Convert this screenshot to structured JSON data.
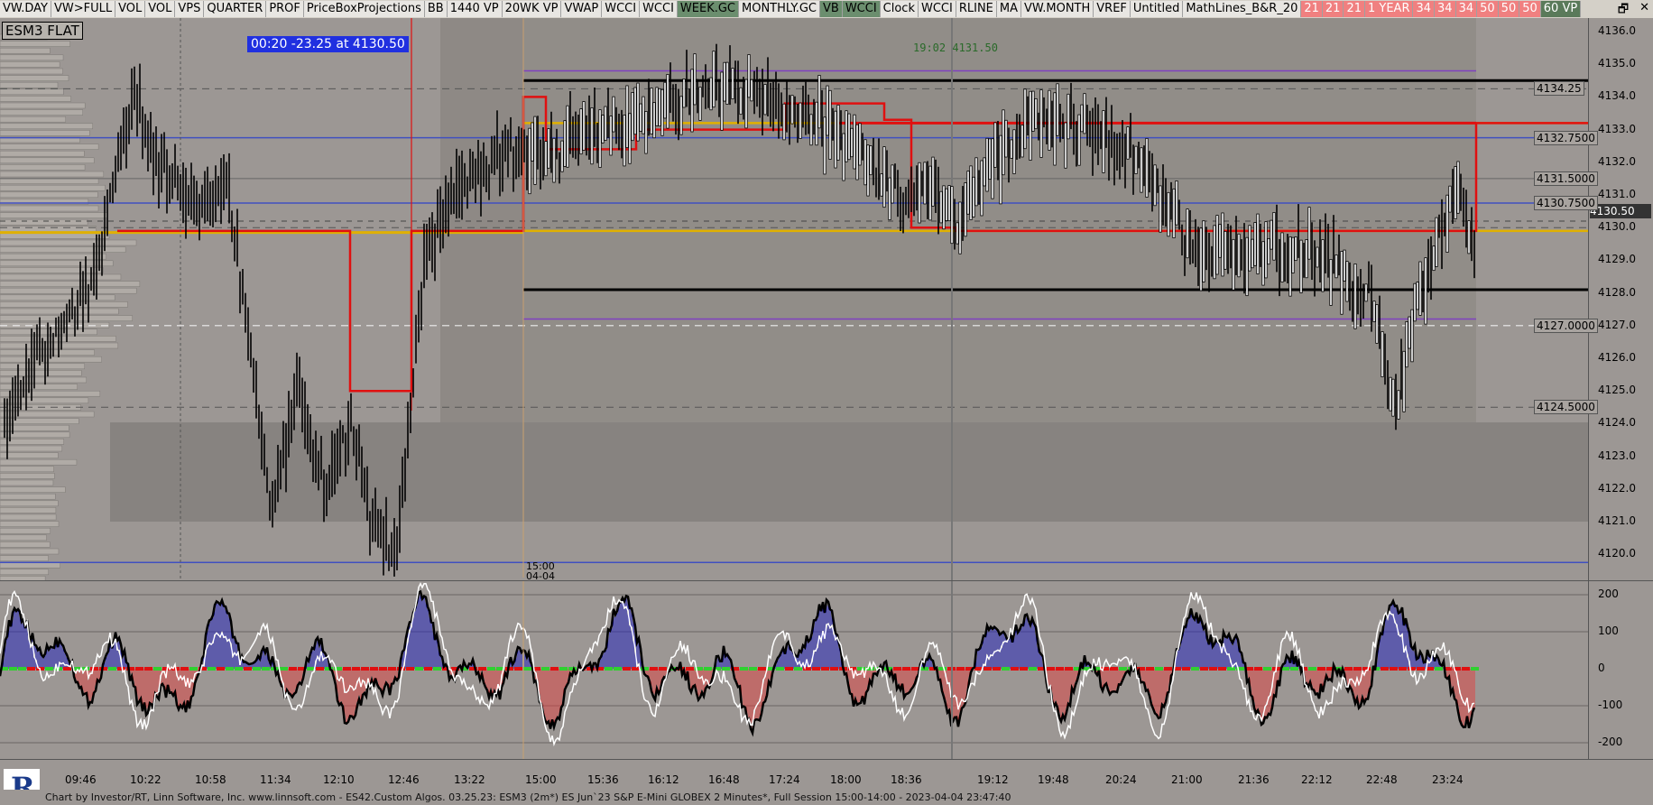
{
  "toolbar": {
    "buttons": [
      "VW.DAY",
      "VW>FULL",
      "VOL",
      "VOL",
      "VPS",
      "QUARTER",
      "PROF",
      "PriceBoxProjections",
      "BB",
      "1440 VP",
      "20WK VP",
      "VWAP",
      "WCCI",
      "WCCI",
      "WEEK.GC",
      "MONTHLY.GC",
      "VB",
      "WCCI",
      "Clock",
      "WCCI",
      "RLINE",
      "MA",
      "VW.MONTH",
      "VREF",
      "Untitled",
      "MathLines_B&R_20",
      "21",
      "21",
      "21",
      "1 YEAR",
      "34",
      "34",
      "34",
      "50",
      "50",
      "50",
      "60 VP"
    ],
    "styles": [
      "n",
      "n",
      "n",
      "n",
      "n",
      "n",
      "n",
      "n",
      "n",
      "n",
      "n",
      "n",
      "n",
      "n",
      "g",
      "n",
      "g",
      "g",
      "n",
      "n",
      "n",
      "n",
      "n",
      "n",
      "n",
      "n",
      "p",
      "p",
      "p",
      "p",
      "p",
      "p",
      "p",
      "p",
      "p",
      "p",
      "dk"
    ]
  },
  "window_controls": {
    "restore": "🗗",
    "close": "✕"
  },
  "symbol": "ESM3 FLAT",
  "info_box": "00:20  -23.25 at 4130.50",
  "crosshair_label": "19:02  4131.50",
  "session_marker": {
    "time": "15:00",
    "date": "04-04"
  },
  "price_axis": {
    "ticks": [
      "4136.0",
      "4135.0",
      "4134.0",
      "4133.0",
      "4132.0",
      "4131.0",
      "4130.0",
      "4129.0",
      "4128.0",
      "4127.0",
      "4126.0",
      "4125.0",
      "4124.0",
      "4123.0",
      "4122.0",
      "4121.0",
      "4120.0"
    ],
    "price_tags": [
      "4134.25",
      "4132.7500",
      "4131.5000",
      "4130.7500",
      "4127.0000",
      "4124.5000"
    ],
    "current_price": "4130.50"
  },
  "osc_axis": {
    "ticks": [
      "200",
      "100",
      "0",
      "-100",
      "-200"
    ]
  },
  "time_axis": {
    "labels": [
      "09:46",
      "10:22",
      "10:58",
      "11:34",
      "12:10",
      "12:46",
      "13:22",
      "15:00",
      "15:36",
      "16:12",
      "16:48",
      "17:24",
      "18:00",
      "18:36",
      "19:12",
      "19:48",
      "20:24",
      "21:00",
      "21:36",
      "22:12",
      "22:48",
      "23:24"
    ]
  },
  "footer": "Chart by Investor/RT, Linn Software, Inc. www.linnsoft.com - ES42.Custom Algos.   03.25.23: ESM3 (2m*) ES Jun`23 S&P E-Mini GLOBEX 2 Minutes*, Full Session 15:00-14:00 - 2023-04-04 23:47:40",
  "colors": {
    "bg": "#9c9794",
    "profile": "#b0aba6",
    "red": "#e01010",
    "yellow": "#e0b000",
    "blue": "#4050c0",
    "purple": "#8040c0",
    "black": "#000000",
    "cci_up": "#2020c0",
    "cci_down": "#e04040",
    "zero_green": "#30d030"
  }
}
